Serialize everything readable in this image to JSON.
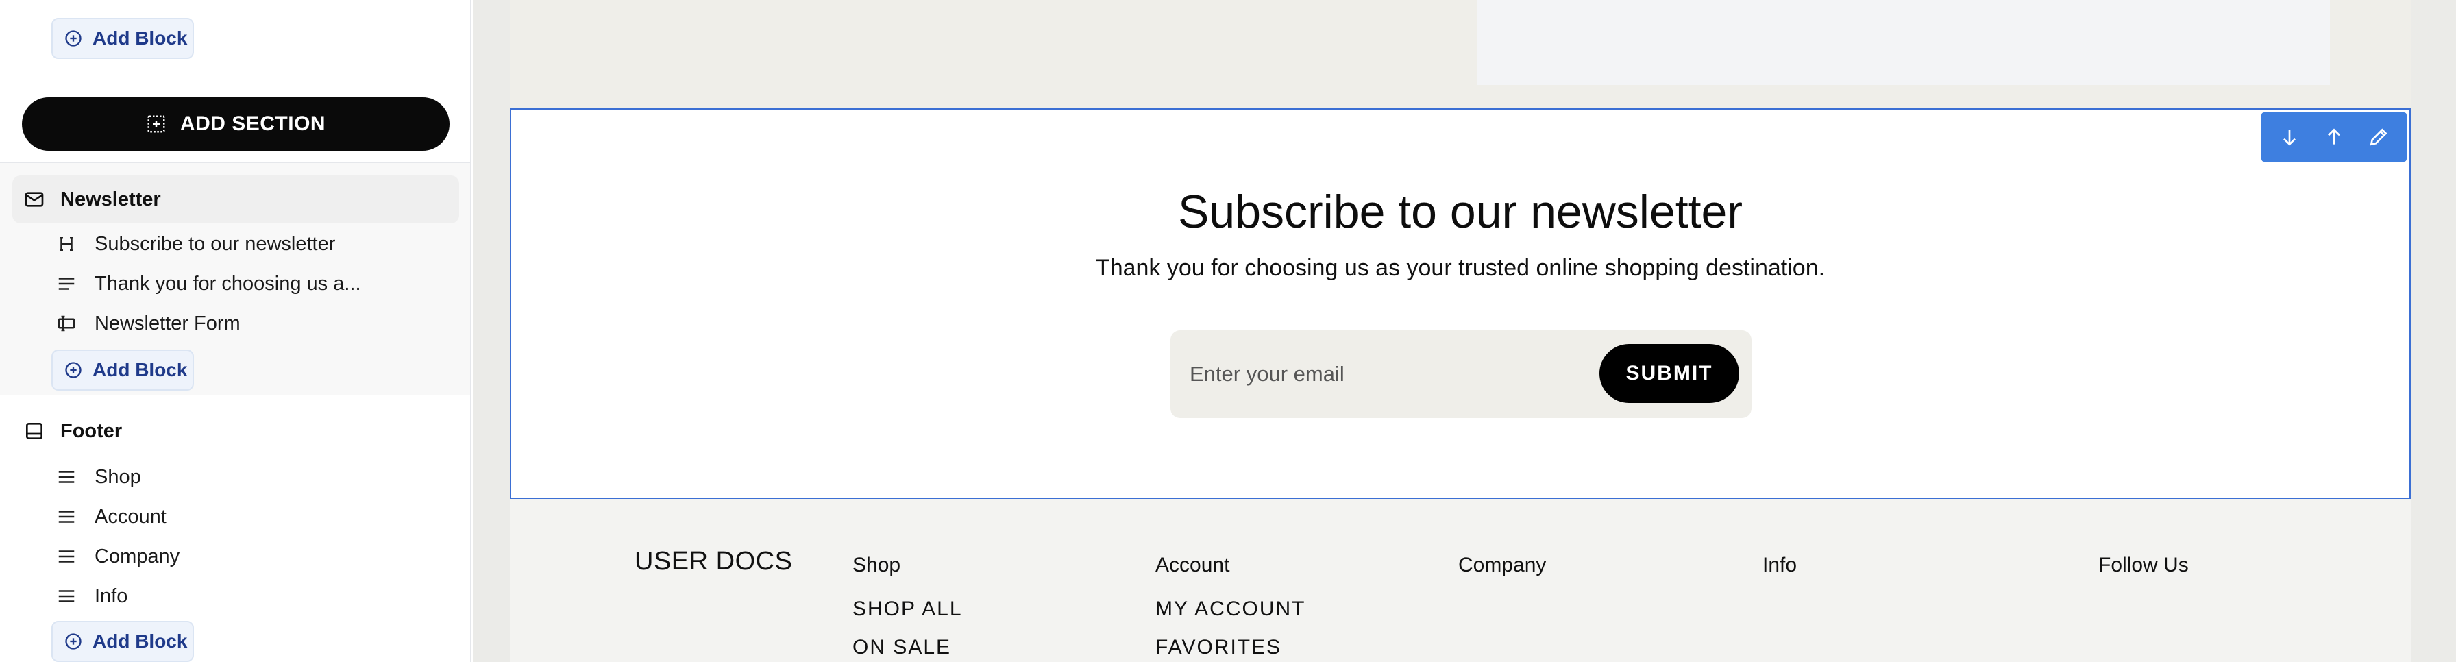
{
  "sidebar": {
    "add_block_label": "Add Block",
    "add_section_label": "ADD SECTION",
    "sections": [
      {
        "title": "Newsletter",
        "icon": "mail-icon",
        "blocks": [
          {
            "label": "Subscribe to our newsletter",
            "icon": "heading-icon"
          },
          {
            "label": "Thank you for choosing us a...",
            "icon": "text-lines-icon"
          },
          {
            "label": "Newsletter Form",
            "icon": "form-icon"
          }
        ]
      },
      {
        "title": "Footer",
        "icon": "footer-layout-icon",
        "blocks": [
          {
            "label": "Shop",
            "icon": "menu-icon"
          },
          {
            "label": "Account",
            "icon": "menu-icon"
          },
          {
            "label": "Company",
            "icon": "menu-icon"
          },
          {
            "label": "Info",
            "icon": "menu-icon"
          }
        ]
      }
    ]
  },
  "newsletter": {
    "heading": "Subscribe to our newsletter",
    "text": "Thank you for choosing us as your trusted online shopping destination.",
    "email_placeholder": "Enter your email",
    "submit_label": "SUBMIT",
    "toolbar": [
      "arrow-down-icon",
      "arrow-up-icon",
      "pencil-icon"
    ]
  },
  "footer": {
    "logo": "USER DOCS",
    "columns": [
      {
        "heading": "Shop",
        "links": [
          "SHOP ALL",
          "ON SALE"
        ]
      },
      {
        "heading": "Account",
        "links": [
          "MY ACCOUNT",
          "FAVORITES"
        ]
      },
      {
        "heading": "Company",
        "links": []
      },
      {
        "heading": "Info",
        "links": []
      },
      {
        "heading": "Follow Us",
        "links": []
      }
    ]
  },
  "colors": {
    "accent": "#3e7fe0",
    "selection_border": "#3b6fd4",
    "primary_button": "#000000",
    "add_block_text": "#1f3a8a"
  }
}
